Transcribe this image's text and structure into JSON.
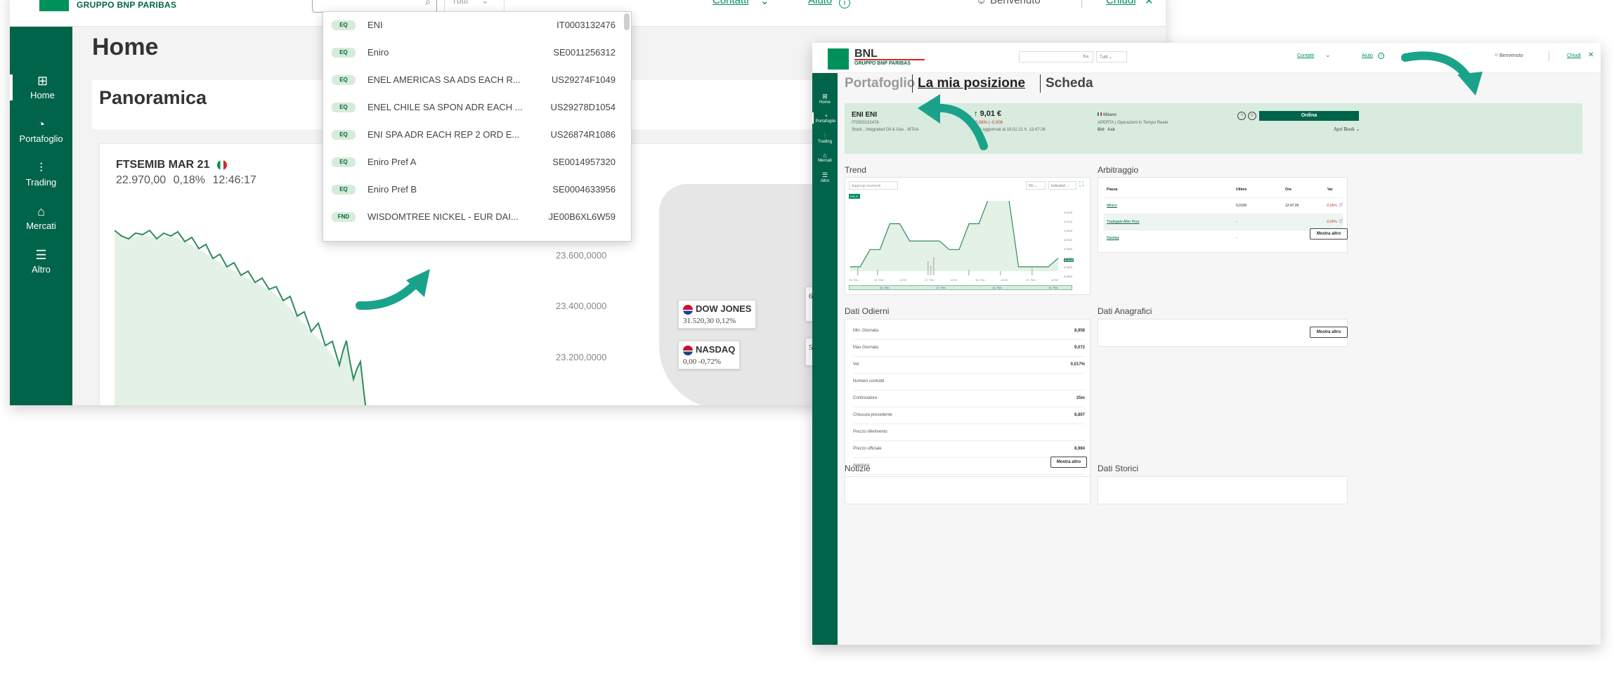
{
  "colors": {
    "brand_dark": "#00644a",
    "brand": "#00915a",
    "accent_arrow": "#1aa38a"
  },
  "screen1": {
    "logo_text": "GRUPPO BNP PARIBAS",
    "search": {
      "placeholder": "",
      "filter": "Tutti"
    },
    "top_links": {
      "contatti": "Contatti",
      "aiuto": "Aiuto",
      "user": "Benvenuto",
      "chiudi": "Chiudi"
    },
    "sidebar": [
      {
        "label": "Home",
        "icon": "home-icon"
      },
      {
        "label": "Portafoglio",
        "icon": "pie-chart-icon"
      },
      {
        "label": "Trading",
        "icon": "trading-icon"
      },
      {
        "label": "Mercati",
        "icon": "bank-icon"
      },
      {
        "label": "Altro",
        "icon": "menu-icon"
      }
    ],
    "page_title": "Home",
    "panel_title": "Panoramica",
    "ftse": {
      "name": "FTSEMIB MAR 21",
      "price": "22.970,00",
      "change": "0,18%",
      "time": "12:46:17"
    },
    "yticks": [
      "23.600,0000",
      "23.400,0000",
      "23.200,0000"
    ],
    "markets": [
      {
        "name": "DOW JONES",
        "value": "31.520,30",
        "change": "0,12%"
      },
      {
        "name": "NASDAQ",
        "value": "0,00",
        "change": "-0,72%"
      }
    ],
    "side_fragments": [
      "6,",
      "5"
    ],
    "dropdown": [
      {
        "type": "EQ",
        "name": "ENI",
        "code": "IT0003132476"
      },
      {
        "type": "EQ",
        "name": "Eniro",
        "code": "SE0011256312"
      },
      {
        "type": "EQ",
        "name": "ENEL AMERICAS SA ADS EACH R...",
        "code": "US29274F1049"
      },
      {
        "type": "EQ",
        "name": "ENEL CHILE SA SPON ADR EACH ...",
        "code": "US29278D1054"
      },
      {
        "type": "EQ",
        "name": "ENI SPA ADR EACH REP 2 ORD E...",
        "code": "US26874R1086"
      },
      {
        "type": "EQ",
        "name": "Eniro Pref A",
        "code": "SE0014957320"
      },
      {
        "type": "EQ",
        "name": "Eniro Pref B",
        "code": "SE0004633956"
      },
      {
        "type": "FND",
        "name": "WISDOMTREE NICKEL - EUR DAI...",
        "code": "JE00B6XL6W59"
      }
    ]
  },
  "screen2": {
    "logo_bnl": "BNL",
    "logo_sub": "GRUPPO BNP PARIBAS",
    "search_filter": "Tutti",
    "search_btn": "Ka",
    "top_links": {
      "contatti": "Contatti",
      "aiuto": "Aiuto",
      "user": "Benvenuto",
      "chiudi": "Chiudi"
    },
    "sidebar": [
      {
        "label": "Home",
        "icon": "home-icon"
      },
      {
        "label": "Portafoglio",
        "icon": "pie-chart-icon"
      },
      {
        "label": "Trading",
        "icon": "trading-icon"
      },
      {
        "label": "Mercati",
        "icon": "bank-icon"
      },
      {
        "label": "Altro",
        "icon": "menu-icon"
      }
    ],
    "tabs": [
      "Portafoglio",
      "La mia posizione",
      "Scheda"
    ],
    "instrument": {
      "name": "ENI ENI",
      "isin": "IT0003132476",
      "desc": "Stock , Integrated Oil & Gas , MTAA",
      "price": "9,01 €",
      "change": "-0,06% | -0,006",
      "updated": "Dati aggiornati al 18.02.21 h. 12:47:26",
      "market": "Milano",
      "status": "APERTA | Operazioni in Tempo Reale",
      "bid": "Bid",
      "ask": "Ask",
      "order_btn": "Ordina",
      "book_link": "Apri Book"
    },
    "trend": {
      "title": "Trend",
      "search_placeholder": "Aggiungi strumenti",
      "period": "6G",
      "indicators": "Indicatori",
      "tag": "ENI",
      "yticks": [
        "9,0200",
        "9,0100",
        "9,0000",
        "8,9900",
        "8,9800",
        "8,9700",
        "8,9600",
        "8,9500"
      ],
      "last": "9,0100",
      "xticks": [
        "15. Feb",
        "16. Feb",
        "12:00",
        "17. Feb",
        "12:00",
        "18. Feb",
        "12:00",
        "19. Feb",
        "12:00"
      ],
      "nav_ticks": [
        "16. Feb",
        "17. Feb",
        "18. Feb",
        "19. Feb"
      ]
    },
    "chart_data": {
      "type": "line",
      "series": [
        {
          "name": "ENI",
          "values": [
            8.955,
            8.955,
            8.975,
            8.975,
            9.005,
            9.005,
            8.985,
            8.985,
            8.985,
            8.985,
            8.975,
            8.975,
            9.005,
            9.005,
            9.035,
            9.035,
            9.035,
            8.955,
            8.955,
            8.955,
            8.955,
            8.965
          ]
        }
      ],
      "ylim": [
        8.95,
        9.025
      ],
      "xlabel": "",
      "ylabel": ""
    },
    "arbitraggio": {
      "title": "Arbitraggio",
      "headers": [
        "Piazza",
        "Ultimo",
        "Ora",
        "Var"
      ],
      "rows": [
        {
          "piazza": "Milano",
          "ultimo": "9,0100",
          "ora": "12:47:26",
          "var": "-0,06%"
        },
        {
          "piazza": "Tradegate After Hour",
          "ultimo": "-",
          "ora": "",
          "var": "-0,06%"
        },
        {
          "piazza": "Nasdaq",
          "ultimo": "-",
          "ora": "",
          "var": "-"
        }
      ],
      "more": "Mostra altro"
    },
    "dati_odierni": {
      "title": "Dati Odierni",
      "rows": [
        {
          "label": "Min. Giornata",
          "value": "8,958"
        },
        {
          "label": "Max Giornata",
          "value": "9,072"
        },
        {
          "label": "Vol",
          "value": "0,017%"
        },
        {
          "label": "Numero contratti",
          "value": ""
        },
        {
          "label": "Controvalore",
          "value": "25m"
        },
        {
          "label": "Chiusura precedente",
          "value": "8,807"
        },
        {
          "label": "Prezzo riferimento",
          "value": ""
        },
        {
          "label": "Prezzo ufficiale",
          "value": "8,984"
        },
        {
          "label": "Apertura",
          "value": "8,801"
        }
      ],
      "more": "Mostra altro"
    },
    "dati_anagrafici": {
      "title": "Dati Anagrafici",
      "more": "Mostra altro"
    },
    "notizie": {
      "title": "Notizie"
    },
    "dati_storici": {
      "title": "Dati Storici"
    }
  }
}
